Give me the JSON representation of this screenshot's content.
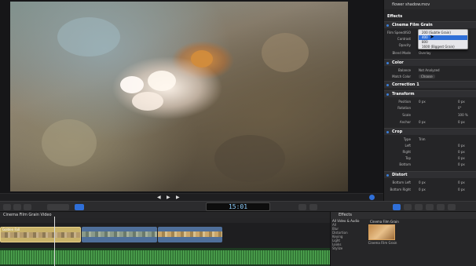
{
  "viewer": {
    "timecode": "15:01"
  },
  "timeline": {
    "header": "Cinema Film Grain Video",
    "clips": [
      {
        "name": "Golden Fall"
      },
      {
        "name": ""
      },
      {
        "name": ""
      }
    ]
  },
  "effects_browser": {
    "title": "Effects",
    "subtitle": "All Video & Audio",
    "categories": [
      "All",
      "Blur",
      "Distortion",
      "Keying",
      "Light",
      "Looks",
      "Stylize"
    ],
    "selected_effect": "Cinema Film Grain",
    "thumb_label": "Cinema Film Grain"
  },
  "inspector": {
    "title": "flower shadow.mov",
    "effects_heading": "Effects",
    "sections": {
      "film_grain": "Cinema Film Grain",
      "color": "Color",
      "correction": "Correction 1",
      "transform": "Transform",
      "crop": "Crop",
      "distort": "Distort"
    },
    "rows": {
      "film_speed": {
        "label": "Film Speed/ISO",
        "value": "400 (Middle Grain)"
      },
      "contrast": {
        "label": "Contrast",
        "value": ""
      },
      "opacity": {
        "label": "Opacity",
        "value": ""
      },
      "blend_mode": {
        "label": "Blend Mode",
        "value": "Overlay"
      },
      "balance": {
        "label": "Balance",
        "value": "Not Analyzed"
      },
      "match_color": {
        "label": "Match Color",
        "value": "Choose"
      },
      "position": {
        "label": "Position",
        "x": "0 px",
        "y": "0 px"
      },
      "rotation": {
        "label": "Rotation",
        "value": "0°"
      },
      "scale": {
        "label": "Scale",
        "value": "100 %"
      },
      "anchor": {
        "label": "Anchor",
        "x": "0 px",
        "y": "0 px"
      },
      "type": {
        "label": "Type",
        "value": "Trim"
      },
      "left": {
        "label": "Left",
        "value": "0 px"
      },
      "right": {
        "label": "Right",
        "value": "0 px"
      },
      "top": {
        "label": "Top",
        "value": "0 px"
      },
      "bottom": {
        "label": "Bottom",
        "value": "0 px"
      },
      "bottom_left": {
        "label": "Bottom Left",
        "x": "0 px",
        "y": "0 px"
      },
      "bottom_right": {
        "label": "Bottom Right",
        "x": "0 px",
        "y": "0 px"
      }
    },
    "dropdown": {
      "options": [
        "200 (Subtle Grain)",
        "400",
        "800",
        "1600 (Biggest Grain)"
      ],
      "selected_index": 1
    }
  },
  "colors": {
    "accent": "#2f6fd8",
    "clip_yellow": "#c9b36a",
    "clip_blue": "#4f6f9a",
    "audio_green": "#3d8a3f"
  }
}
